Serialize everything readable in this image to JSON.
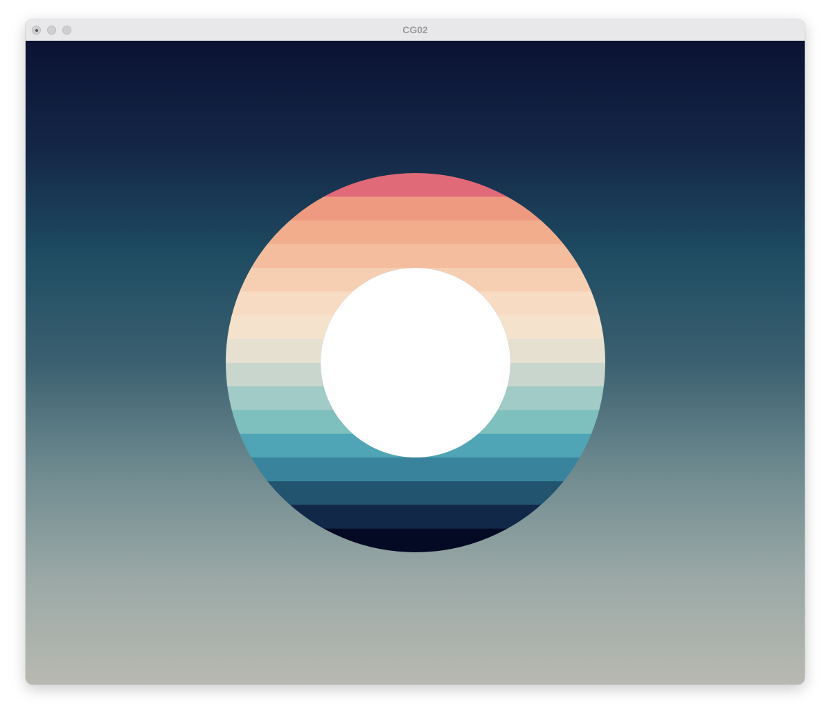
{
  "window": {
    "title": "CG02"
  },
  "controls": {
    "close_icon": "close-icon",
    "minimize_icon": "minimize-icon",
    "zoom_icon": "zoom-icon"
  },
  "scene": {
    "background_gradient": [
      "#0b1234",
      "#142646",
      "#1e4c62",
      "#3b6070",
      "#6e8a8f",
      "#9aa8a6",
      "#b8b9b1"
    ],
    "ring_bands": [
      "#e06a78",
      "#ee9a80",
      "#f2ad8c",
      "#f4bd9d",
      "#f6cfb3",
      "#f7dcc3",
      "#f5e2cd",
      "#e6e0d0",
      "#c9d6cd",
      "#a0cbc6",
      "#7dc0bd",
      "#4fa5b5",
      "#39849c",
      "#22546f",
      "#112848",
      "#050a24"
    ],
    "hole_color": "#ffffff"
  }
}
